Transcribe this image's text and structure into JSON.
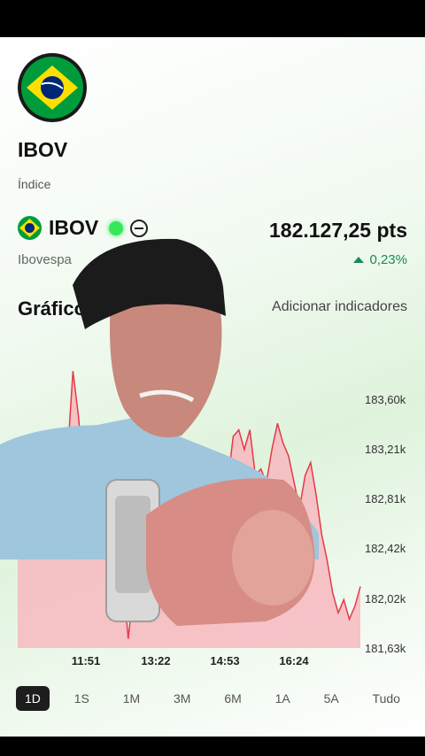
{
  "header": {
    "title": "IBOV",
    "subtitle": "Índice"
  },
  "quote": {
    "ticker": "IBOV",
    "name": "Ibovespa",
    "price": "182.127,25 pts",
    "change": "0,23%",
    "status": "live"
  },
  "chart_section": {
    "title": "Gráfico",
    "add_indicators": "Adicionar indicadores"
  },
  "chart_data": {
    "type": "area",
    "y_ticks": [
      "183,60k",
      "183,21k",
      "182,81k",
      "182,42k",
      "182,02k",
      "181,63k"
    ],
    "x_ticks": [
      "11:51",
      "13:22",
      "14:53",
      "16:24"
    ],
    "ylim": [
      181630,
      183600
    ],
    "series": [
      {
        "values": [
          182500,
          182450,
          182550,
          182420,
          182480,
          182600,
          182520,
          182650,
          182700,
          183100,
          183750,
          183400,
          182900,
          182700,
          182800,
          182600,
          182500,
          182700,
          182400,
          182200,
          181700,
          182100,
          181900,
          182300,
          182000,
          182500,
          182300,
          182700,
          182900,
          182600,
          182800,
          183000,
          182700,
          182900,
          182800,
          183000,
          182900,
          183100,
          182900,
          183250,
          183300,
          183150,
          183300,
          182950,
          183000,
          182900,
          183150,
          183350,
          183200,
          183100,
          182900,
          182700,
          182950,
          183050,
          182800,
          182500,
          182300,
          182050,
          181900,
          182000,
          181850,
          181950,
          182100
        ]
      }
    ],
    "area_color": "#f7b9c0",
    "line_color": "#e53945"
  },
  "periods": [
    "1D",
    "1S",
    "1M",
    "3M",
    "6M",
    "1A",
    "5A",
    "Tudo"
  ],
  "selected_period": "1D",
  "colors": {
    "accent_green": "#34e85a",
    "positive": "#1b8a56"
  }
}
